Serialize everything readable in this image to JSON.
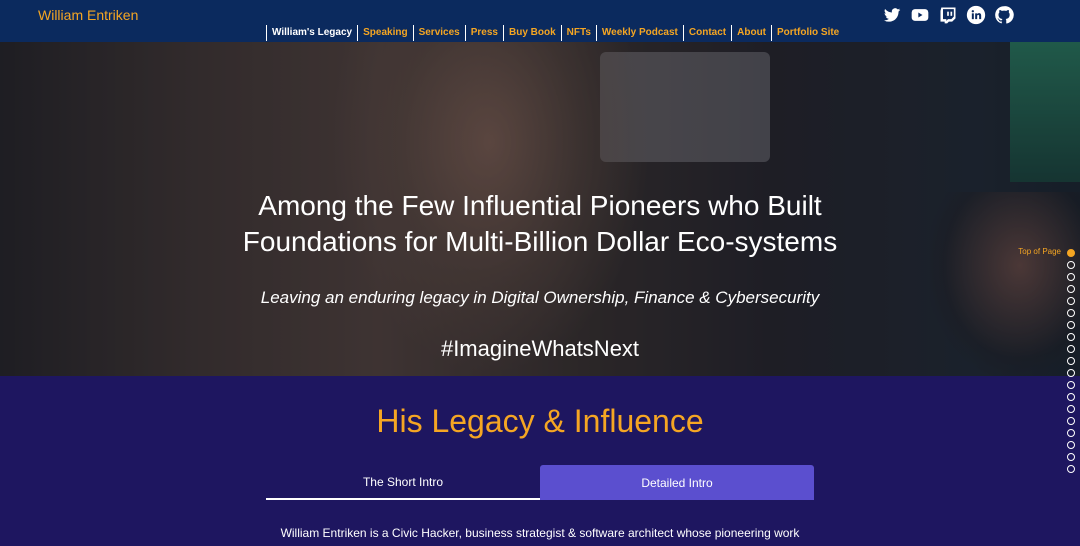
{
  "header": {
    "site_title": "William Entriken",
    "nav": [
      {
        "label": "William's Legacy",
        "active": true
      },
      {
        "label": "Speaking"
      },
      {
        "label": "Services"
      },
      {
        "label": "Press"
      },
      {
        "label": "Buy Book"
      },
      {
        "label": "NFTs"
      },
      {
        "label": "Weekly Podcast"
      },
      {
        "label": "Contact"
      },
      {
        "label": "About"
      },
      {
        "label": "Portfolio Site"
      }
    ],
    "social_icons": [
      "twitter-icon",
      "youtube-icon",
      "twitch-icon",
      "linkedin-icon",
      "github-icon"
    ]
  },
  "hero": {
    "title_line1": "Among the Few Influential Pioneers who Built",
    "title_line2": "Foundations for Multi-Billion Dollar Eco-systems",
    "subtitle": "Leaving an enduring legacy in Digital Ownership, Finance & Cybersecurity",
    "hashtag": "#ImagineWhatsNext"
  },
  "section": {
    "title": "His Legacy & Influence",
    "tabs": [
      {
        "label": "The Short Intro"
      },
      {
        "label": "Detailed Intro",
        "selected": true
      }
    ],
    "intro_text": "William Entriken is a Civic Hacker, business strategist & software architect whose pioneering work"
  },
  "page_nav": {
    "top_label": "Top of Page",
    "dot_count": 19,
    "active_index": 0
  },
  "colors": {
    "header_bg": "#0b2a5e",
    "accent": "#f5a623",
    "section_bg": "#1e1660",
    "tab_selected": "#5b4fcf"
  }
}
